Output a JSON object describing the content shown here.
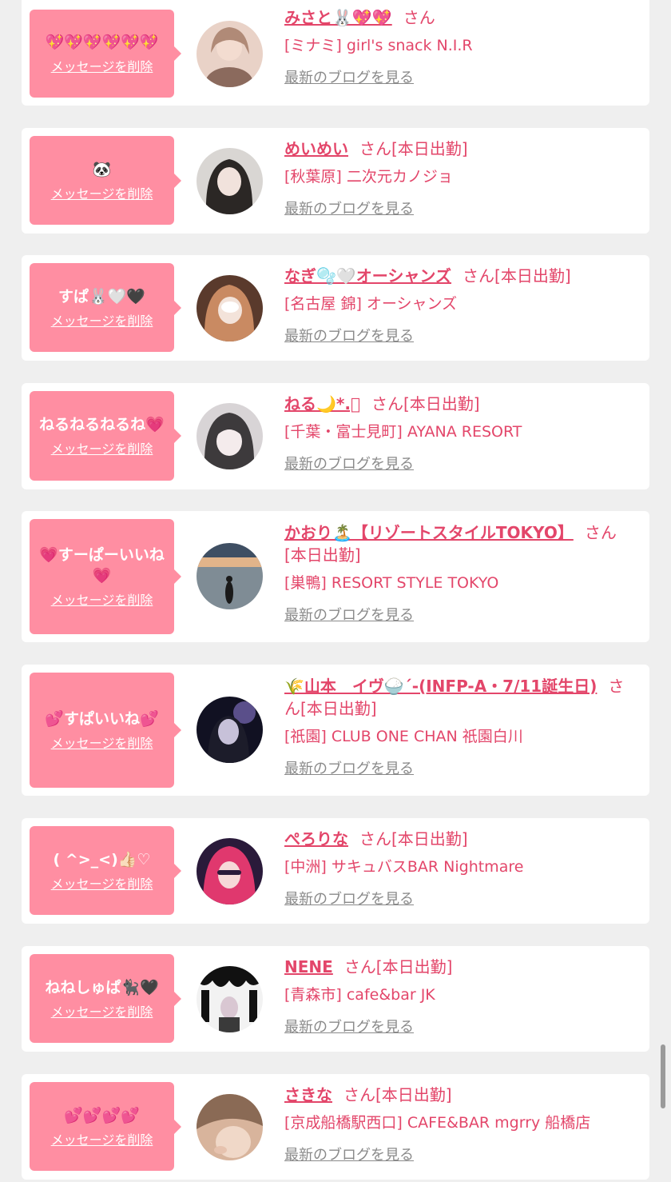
{
  "favorites": [
    {
      "message": "💖💖💖💖💖💖",
      "delete_label": "メッセージを削除",
      "name": "みさと🐰💖💖",
      "suffix": "さん",
      "shop": "[ミナミ] girl's snack N.I.R",
      "blog_label": "最新のブログを見る",
      "avatar_colors": [
        "#e9d2c7",
        "#8b6a5d"
      ]
    },
    {
      "message": "🐼",
      "delete_label": "メッセージを削除",
      "name": "めいめい",
      "suffix": "さん[本日出勤]",
      "shop": "[秋葉原] 二次元カノジョ",
      "blog_label": "最新のブログを見る",
      "avatar_colors": [
        "#d9d6d3",
        "#2b2725"
      ]
    },
    {
      "message": "すぱ🐰🤍🖤",
      "delete_label": "メッセージを削除",
      "name": "なぎ🫧🤍オーシャンズ",
      "suffix": "さん[本日出勤]",
      "shop": "[名古屋 錦] オーシャンズ",
      "blog_label": "最新のブログを見る",
      "avatar_colors": [
        "#e4a88a",
        "#5a3a2c"
      ]
    },
    {
      "message": "ねるねるねるね💗",
      "delete_label": "メッセージを削除",
      "name": "ねる🌙*.ﾟ",
      "suffix": "さん[本日出勤]",
      "shop": "[千葉・富士見町] AYANA RESORT",
      "blog_label": "最新のブログを見る",
      "avatar_colors": [
        "#d8d4d6",
        "#3d3a3c"
      ]
    },
    {
      "message": "💗すーぱーいいね💗",
      "delete_label": "メッセージを削除",
      "name": "かおり🏝️【リゾートスタイルTOKYO】",
      "suffix": "さん[本日出勤]",
      "shop": "[巣鴨] RESORT STYLE TOKYO",
      "blog_label": "最新のブログを見る",
      "avatar_colors": [
        "#e2b48a",
        "#3f4f63"
      ]
    },
    {
      "message": "💕すぱいいね💕",
      "delete_label": "メッセージを削除",
      "name": "🌾山本　イヴ🍚´-(INFP-A・7/11誕生日)",
      "suffix": "さん[本日出勤]",
      "shop": "[祇園] CLUB ONE CHAN 祇園白川",
      "blog_label": "最新のブログを見る",
      "avatar_colors": [
        "#5a4f8a",
        "#111122"
      ]
    },
    {
      "message": "( ^>_<)👍🏻♡",
      "delete_label": "メッセージを削除",
      "name": "ぺろりな",
      "suffix": "さん[本日出勤]",
      "shop": "[中洲] サキュバスBAR Nightmare",
      "blog_label": "最新のブログを見る",
      "avatar_colors": [
        "#e0386e",
        "#2a1a3a"
      ]
    },
    {
      "message": "ねねしゅぱ🐈‍⬛🖤",
      "delete_label": "メッセージを削除",
      "name": "NENE",
      "suffix": "さん[本日出勤]",
      "shop": "[青森市] cafe&bar JK",
      "blog_label": "最新のブログを見る",
      "avatar_colors": [
        "#f2f2f2",
        "#111111"
      ]
    },
    {
      "message": "💕💕💕💕",
      "delete_label": "メッセージを削除",
      "name": "さきな",
      "suffix": "さん[本日出勤]",
      "shop": "[京成船橋駅西口] CAFE&BAR mgrry 船橋店",
      "blog_label": "最新のブログを見る",
      "avatar_colors": [
        "#d8b49c",
        "#8a6a55"
      ]
    }
  ]
}
